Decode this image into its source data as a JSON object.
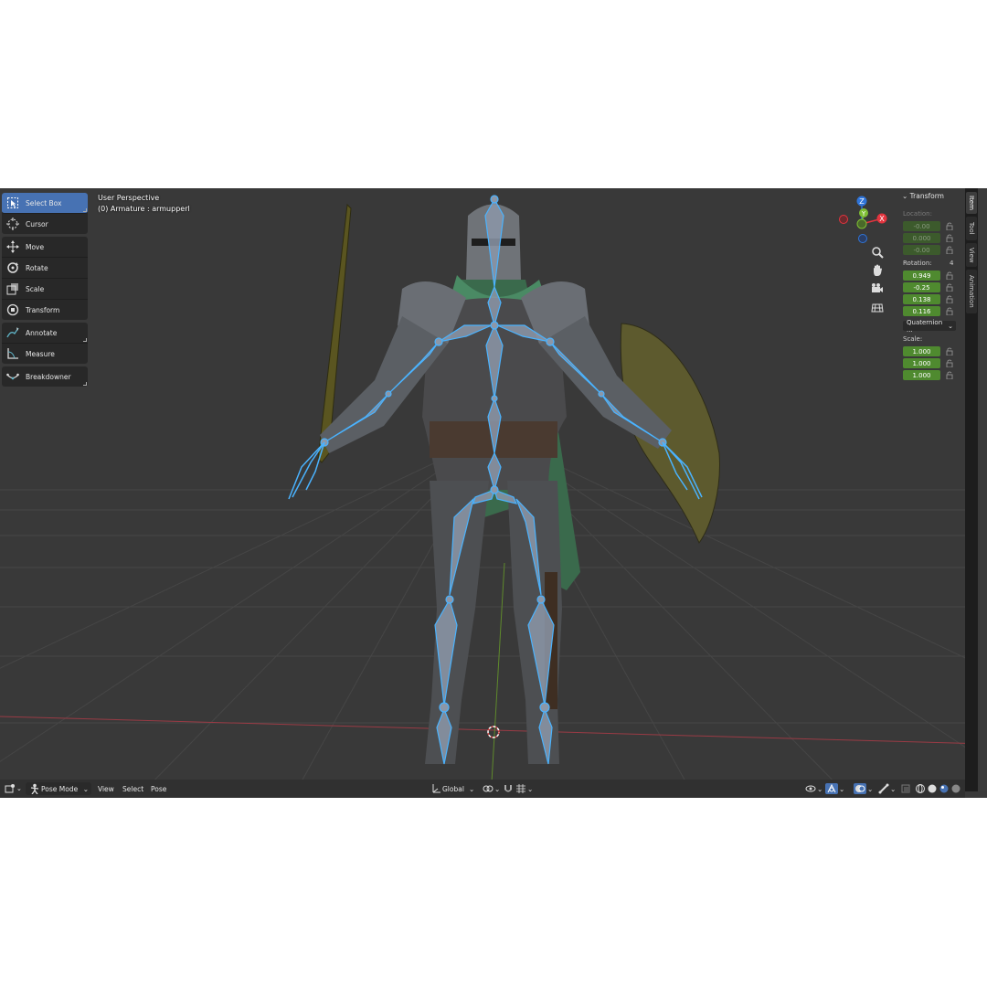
{
  "viewport": {
    "perspective_label": "User Perspective",
    "object_label": "(0) Armature : armupperl"
  },
  "toolbar": {
    "tools": [
      {
        "label": "Select Box",
        "icon": "select-box-icon",
        "active": true
      },
      {
        "label": "Cursor",
        "icon": "cursor-icon"
      },
      {
        "label": "Move",
        "icon": "move-icon"
      },
      {
        "label": "Rotate",
        "icon": "rotate-icon"
      },
      {
        "label": "Scale",
        "icon": "scale-icon"
      },
      {
        "label": "Transform",
        "icon": "transform-icon"
      },
      {
        "label": "Annotate",
        "icon": "annotate-icon"
      },
      {
        "label": "Measure",
        "icon": "measure-icon"
      },
      {
        "label": "Breakdowner",
        "icon": "breakdowner-icon"
      }
    ]
  },
  "gizmo": {
    "z": "Z",
    "y": "Y",
    "x": "X",
    "colors": {
      "x": "#e3343e",
      "y": "#7ebe34",
      "z": "#2f74d8"
    }
  },
  "tabs": [
    "Item",
    "Tool",
    "View",
    "Animation"
  ],
  "npanel": {
    "title": "Transform",
    "location_label": "Location:",
    "location": [
      "-0.00",
      "0.000",
      "-0.00"
    ],
    "rotation_label": "Rotation:",
    "rotation_mode_value": "4",
    "rotation": [
      "0.949",
      "-0.25",
      "0.138",
      "0.116"
    ],
    "rotation_mode": "Quaternion ...",
    "scale_label": "Scale:",
    "scale": [
      "1.000",
      "1.000",
      "1.000"
    ]
  },
  "header": {
    "mode": "Pose Mode",
    "menus": [
      "View",
      "Select",
      "Pose"
    ],
    "orientation": "Global"
  },
  "colors": {
    "viewport_bg": "#393939",
    "accent": "#4772b3",
    "field_green": "#4f8a2f",
    "bone_fill": "#8c97a8",
    "bone_outline": "#4ab3ff"
  }
}
